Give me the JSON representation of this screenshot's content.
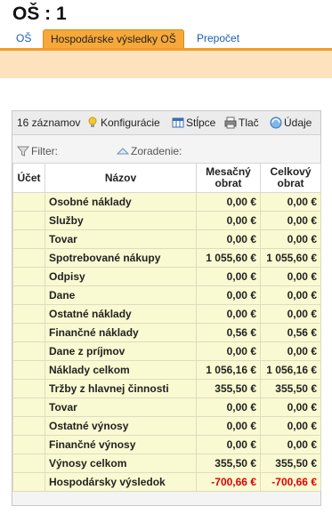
{
  "header": {
    "title": "OŠ :  1"
  },
  "tabs": [
    {
      "label": "OŠ"
    },
    {
      "label": "Hospodárske výsledky OŠ"
    },
    {
      "label": "Prepočet"
    }
  ],
  "toolbar": {
    "count": "16 záznamov",
    "config_label": "Konfigurácie",
    "columns_label": "Stĺpce",
    "print_label": "Tlač",
    "data_label": "Údaje"
  },
  "filterbar": {
    "filter_label": "Filter:",
    "sort_label": "Zoradenie:"
  },
  "table": {
    "headers": [
      "Účet",
      "Názov",
      "Mesačný obrat",
      "Celkový obrat"
    ],
    "rows": [
      {
        "account": "",
        "name": "Osobné náklady",
        "monthly": "0,00 €",
        "total": "0,00 €"
      },
      {
        "account": "",
        "name": "Služby",
        "monthly": "0,00 €",
        "total": "0,00 €"
      },
      {
        "account": "",
        "name": "Tovar",
        "monthly": "0,00 €",
        "total": "0,00 €"
      },
      {
        "account": "",
        "name": "Spotrebované nákupy",
        "monthly": "1 055,60 €",
        "total": "1 055,60 €"
      },
      {
        "account": "",
        "name": "Odpisy",
        "monthly": "0,00 €",
        "total": "0,00 €"
      },
      {
        "account": "",
        "name": "Dane",
        "monthly": "0,00 €",
        "total": "0,00 €"
      },
      {
        "account": "",
        "name": "Ostatné náklady",
        "monthly": "0,00 €",
        "total": "0,00 €"
      },
      {
        "account": "",
        "name": "Finančné náklady",
        "monthly": "0,56 €",
        "total": "0,56 €"
      },
      {
        "account": "",
        "name": "Dane z príjmov",
        "monthly": "0,00 €",
        "total": "0,00 €"
      },
      {
        "account": "",
        "name": "Náklady celkom",
        "monthly": "1 056,16 €",
        "total": "1 056,16 €"
      },
      {
        "account": "",
        "name": "Tržby z hlavnej činnosti",
        "monthly": "355,50 €",
        "total": "355,50 €"
      },
      {
        "account": "",
        "name": "Tovar",
        "monthly": "0,00 €",
        "total": "0,00 €"
      },
      {
        "account": "",
        "name": "Ostatné výnosy",
        "monthly": "0,00 €",
        "total": "0,00 €"
      },
      {
        "account": "",
        "name": "Finančné výnosy",
        "monthly": "0,00 €",
        "total": "0,00 €"
      },
      {
        "account": "",
        "name": "Výnosy celkom",
        "monthly": "355,50 €",
        "total": "355,50 €"
      },
      {
        "account": "",
        "name": "Hospodársky výsledok",
        "monthly": "-700,66 €",
        "total": "-700,66 €",
        "negative": true
      }
    ]
  },
  "colors": {
    "tab_active": "#f6a83a",
    "band": "#fde3bd",
    "row_bg": "#fafad2",
    "negative": "#e00000",
    "link": "#1a5fb4"
  },
  "icons": {
    "config": "lightbulb-icon",
    "columns": "columns-icon",
    "print": "printer-icon",
    "data": "data-icon",
    "filter": "funnel-icon",
    "sort": "sort-icon"
  }
}
